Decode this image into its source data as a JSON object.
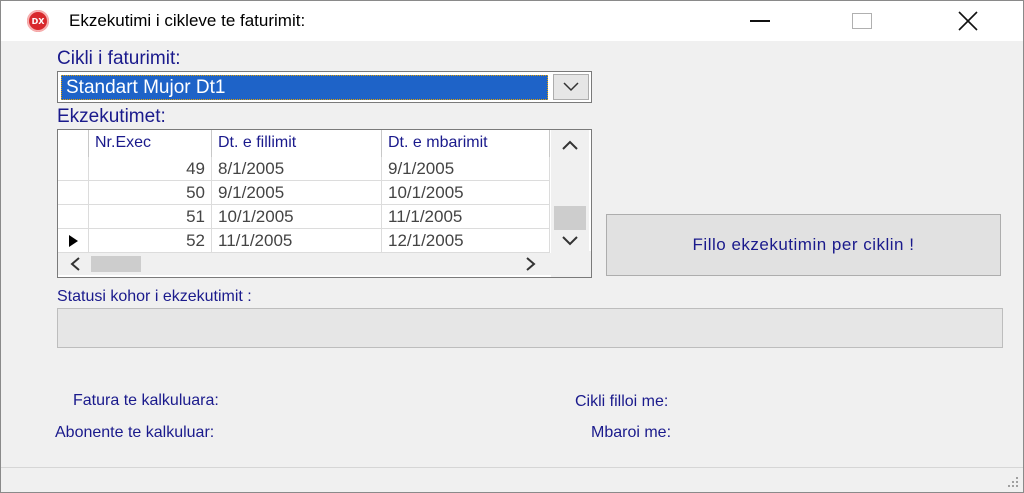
{
  "window": {
    "title": "Ekzekutimi i cikleve te faturimit:",
    "icon_name": "app-logo-icon",
    "icon_text": "DX"
  },
  "cycle": {
    "label": "Cikli i faturimit:",
    "selected": "Standart Mujor Dt1"
  },
  "executions": {
    "label": "Ekzekutimet:",
    "columns": [
      "Nr.Exec",
      "Dt. e fillimit",
      "Dt. e mbarimit"
    ],
    "rows": [
      {
        "nr": "49",
        "start": "8/1/2005",
        "end": "9/1/2005",
        "current": false
      },
      {
        "nr": "50",
        "start": "9/1/2005",
        "end": "10/1/2005",
        "current": false
      },
      {
        "nr": "51",
        "start": "10/1/2005",
        "end": "11/1/2005",
        "current": false
      },
      {
        "nr": "52",
        "start": "11/1/2005",
        "end": "12/1/2005",
        "current": true
      }
    ]
  },
  "run_button": "Fillo ekzekutimin per ciklin !",
  "status": {
    "label": "Statusi kohor i ekzekutimit :",
    "value": ""
  },
  "footer": {
    "invoices_label": "Fatura te  kalkuluara:",
    "subscribers_label": "Abonente te kalkuluar:",
    "cycle_started_label": "Cikli filloi me:",
    "ended_label": "Mbaroi me:"
  },
  "colors": {
    "label_text": "#1a1a8c",
    "selection": "#1e63c8",
    "app_icon": "#d8282c"
  }
}
